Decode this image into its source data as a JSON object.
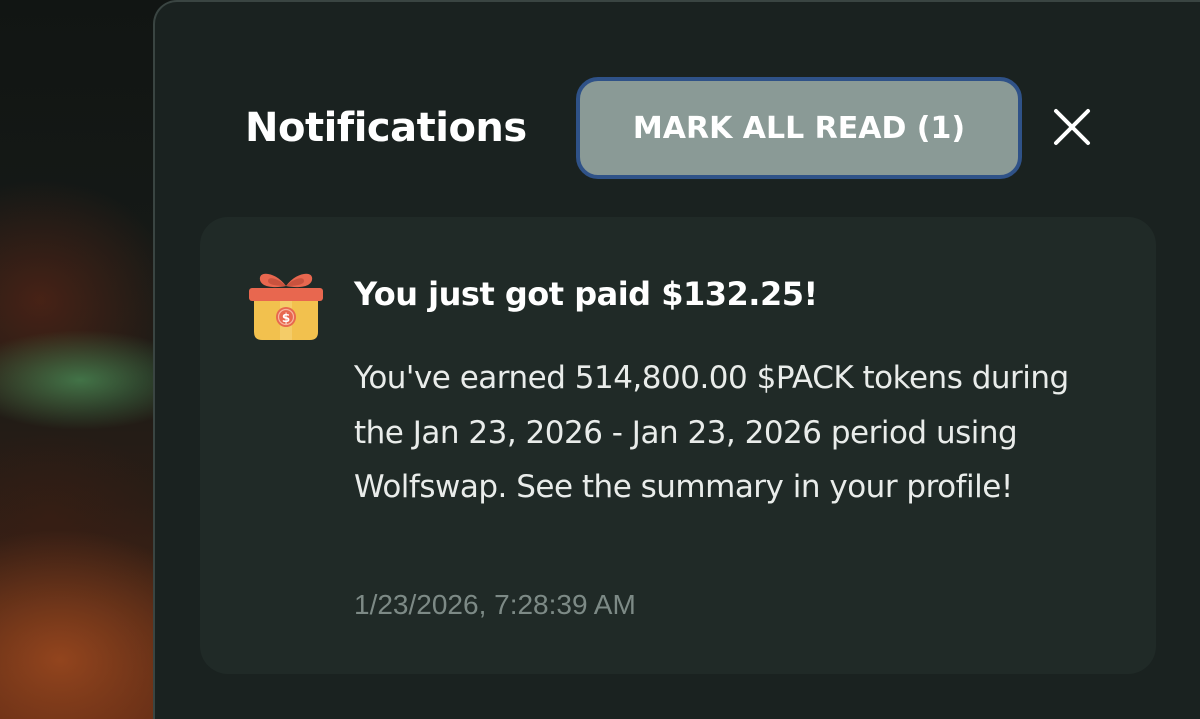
{
  "header": {
    "title": "Notifications",
    "mark_all_read_label": "MARK ALL READ (1)",
    "close_icon": "close-icon"
  },
  "notifications": [
    {
      "icon": "gift-box-icon",
      "title": "You just got paid $132.25!",
      "body": "You've earned 514,800.00 $PACK tokens during the Jan 23, 2026 - Jan 23, 2026 period using Wolfswap. See the summary in your profile!",
      "timestamp": "1/23/2026, 7:28:39 AM"
    }
  ],
  "colors": {
    "panel_background": "#1a2220",
    "card_background": "#202a27",
    "button_fill": "#8a9a96",
    "button_border": "#2f5288",
    "timestamp_text": "#7d8a86",
    "gift_box": "#f2c14e",
    "gift_ribbon": "#e8674f"
  }
}
